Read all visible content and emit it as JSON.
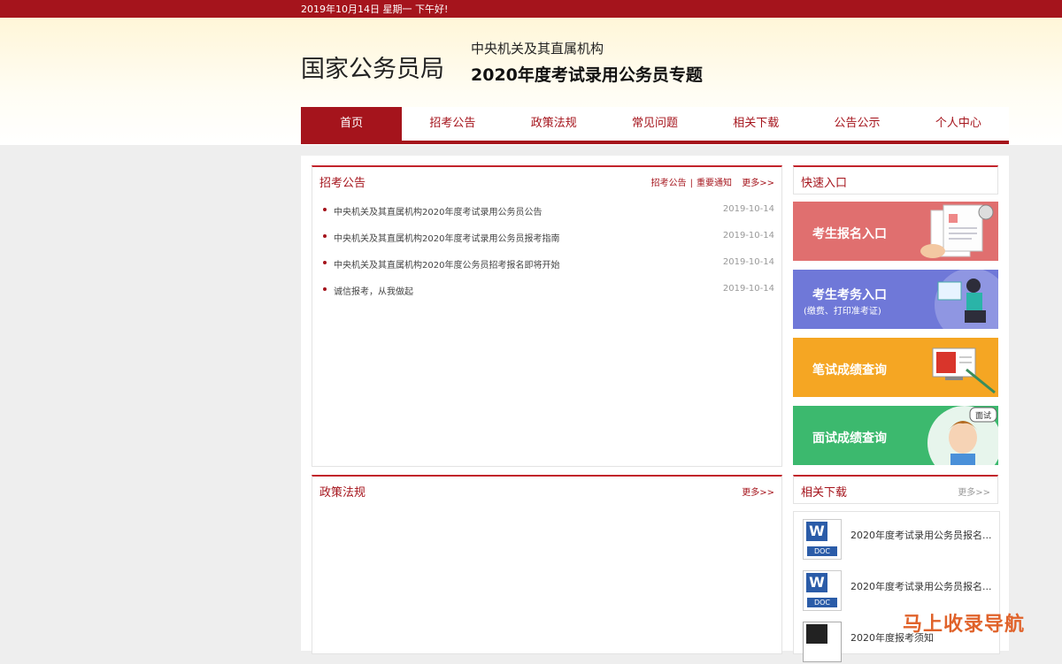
{
  "top_bar": {
    "date_text": "2019年10月14日  星期一  下午好!"
  },
  "header": {
    "logo": "国家公务员局",
    "subtitle1": "中央机关及其直属机构",
    "subtitle2": "2020年度考试录用公务员专题"
  },
  "nav": {
    "items": [
      {
        "label": "首页",
        "active": true
      },
      {
        "label": "招考公告"
      },
      {
        "label": "政策法规"
      },
      {
        "label": "常见问题"
      },
      {
        "label": "相关下载"
      },
      {
        "label": "公告公示"
      },
      {
        "label": "个人中心"
      }
    ]
  },
  "announcements": {
    "title": "招考公告",
    "link1": "招考公告",
    "link2": "重要通知",
    "more": "更多>>",
    "items": [
      {
        "title": "中央机关及其直属机构2020年度考试录用公务员公告",
        "date": "2019-10-14"
      },
      {
        "title": "中央机关及其直属机构2020年度考试录用公务员报考指南",
        "date": "2019-10-14"
      },
      {
        "title": "中央机关及其直属机构2020年度公务员招考报名即将开始",
        "date": "2019-10-14"
      },
      {
        "title": "诚信报考，从我做起",
        "date": "2019-10-14"
      }
    ]
  },
  "policy": {
    "title": "政策法规",
    "more": "更多>>"
  },
  "quick_entry": {
    "title": "快速入口",
    "buttons": [
      {
        "label": "考生报名入口",
        "color": "#e06f6f"
      },
      {
        "label": "考生考务入口",
        "sub": "(缴费、打印准考证)",
        "color": "#6f78d8"
      },
      {
        "label": "笔试成绩查询",
        "color": "#f5a623"
      },
      {
        "label": "面试成绩查询",
        "color": "#3cb96e"
      }
    ],
    "badge": "面试"
  },
  "downloads": {
    "title": "相关下载",
    "more": "更多>>",
    "items": [
      {
        "name": "2020年度考试录用公务员报名..."
      },
      {
        "name": "2020年度考试录用公务员报名..."
      },
      {
        "name": "2020年度报考须知"
      }
    ],
    "icon_letter": "W",
    "icon_label": "DOC"
  },
  "watermark": "马上收录导航",
  "colors": {
    "brand": "#a5141c"
  }
}
